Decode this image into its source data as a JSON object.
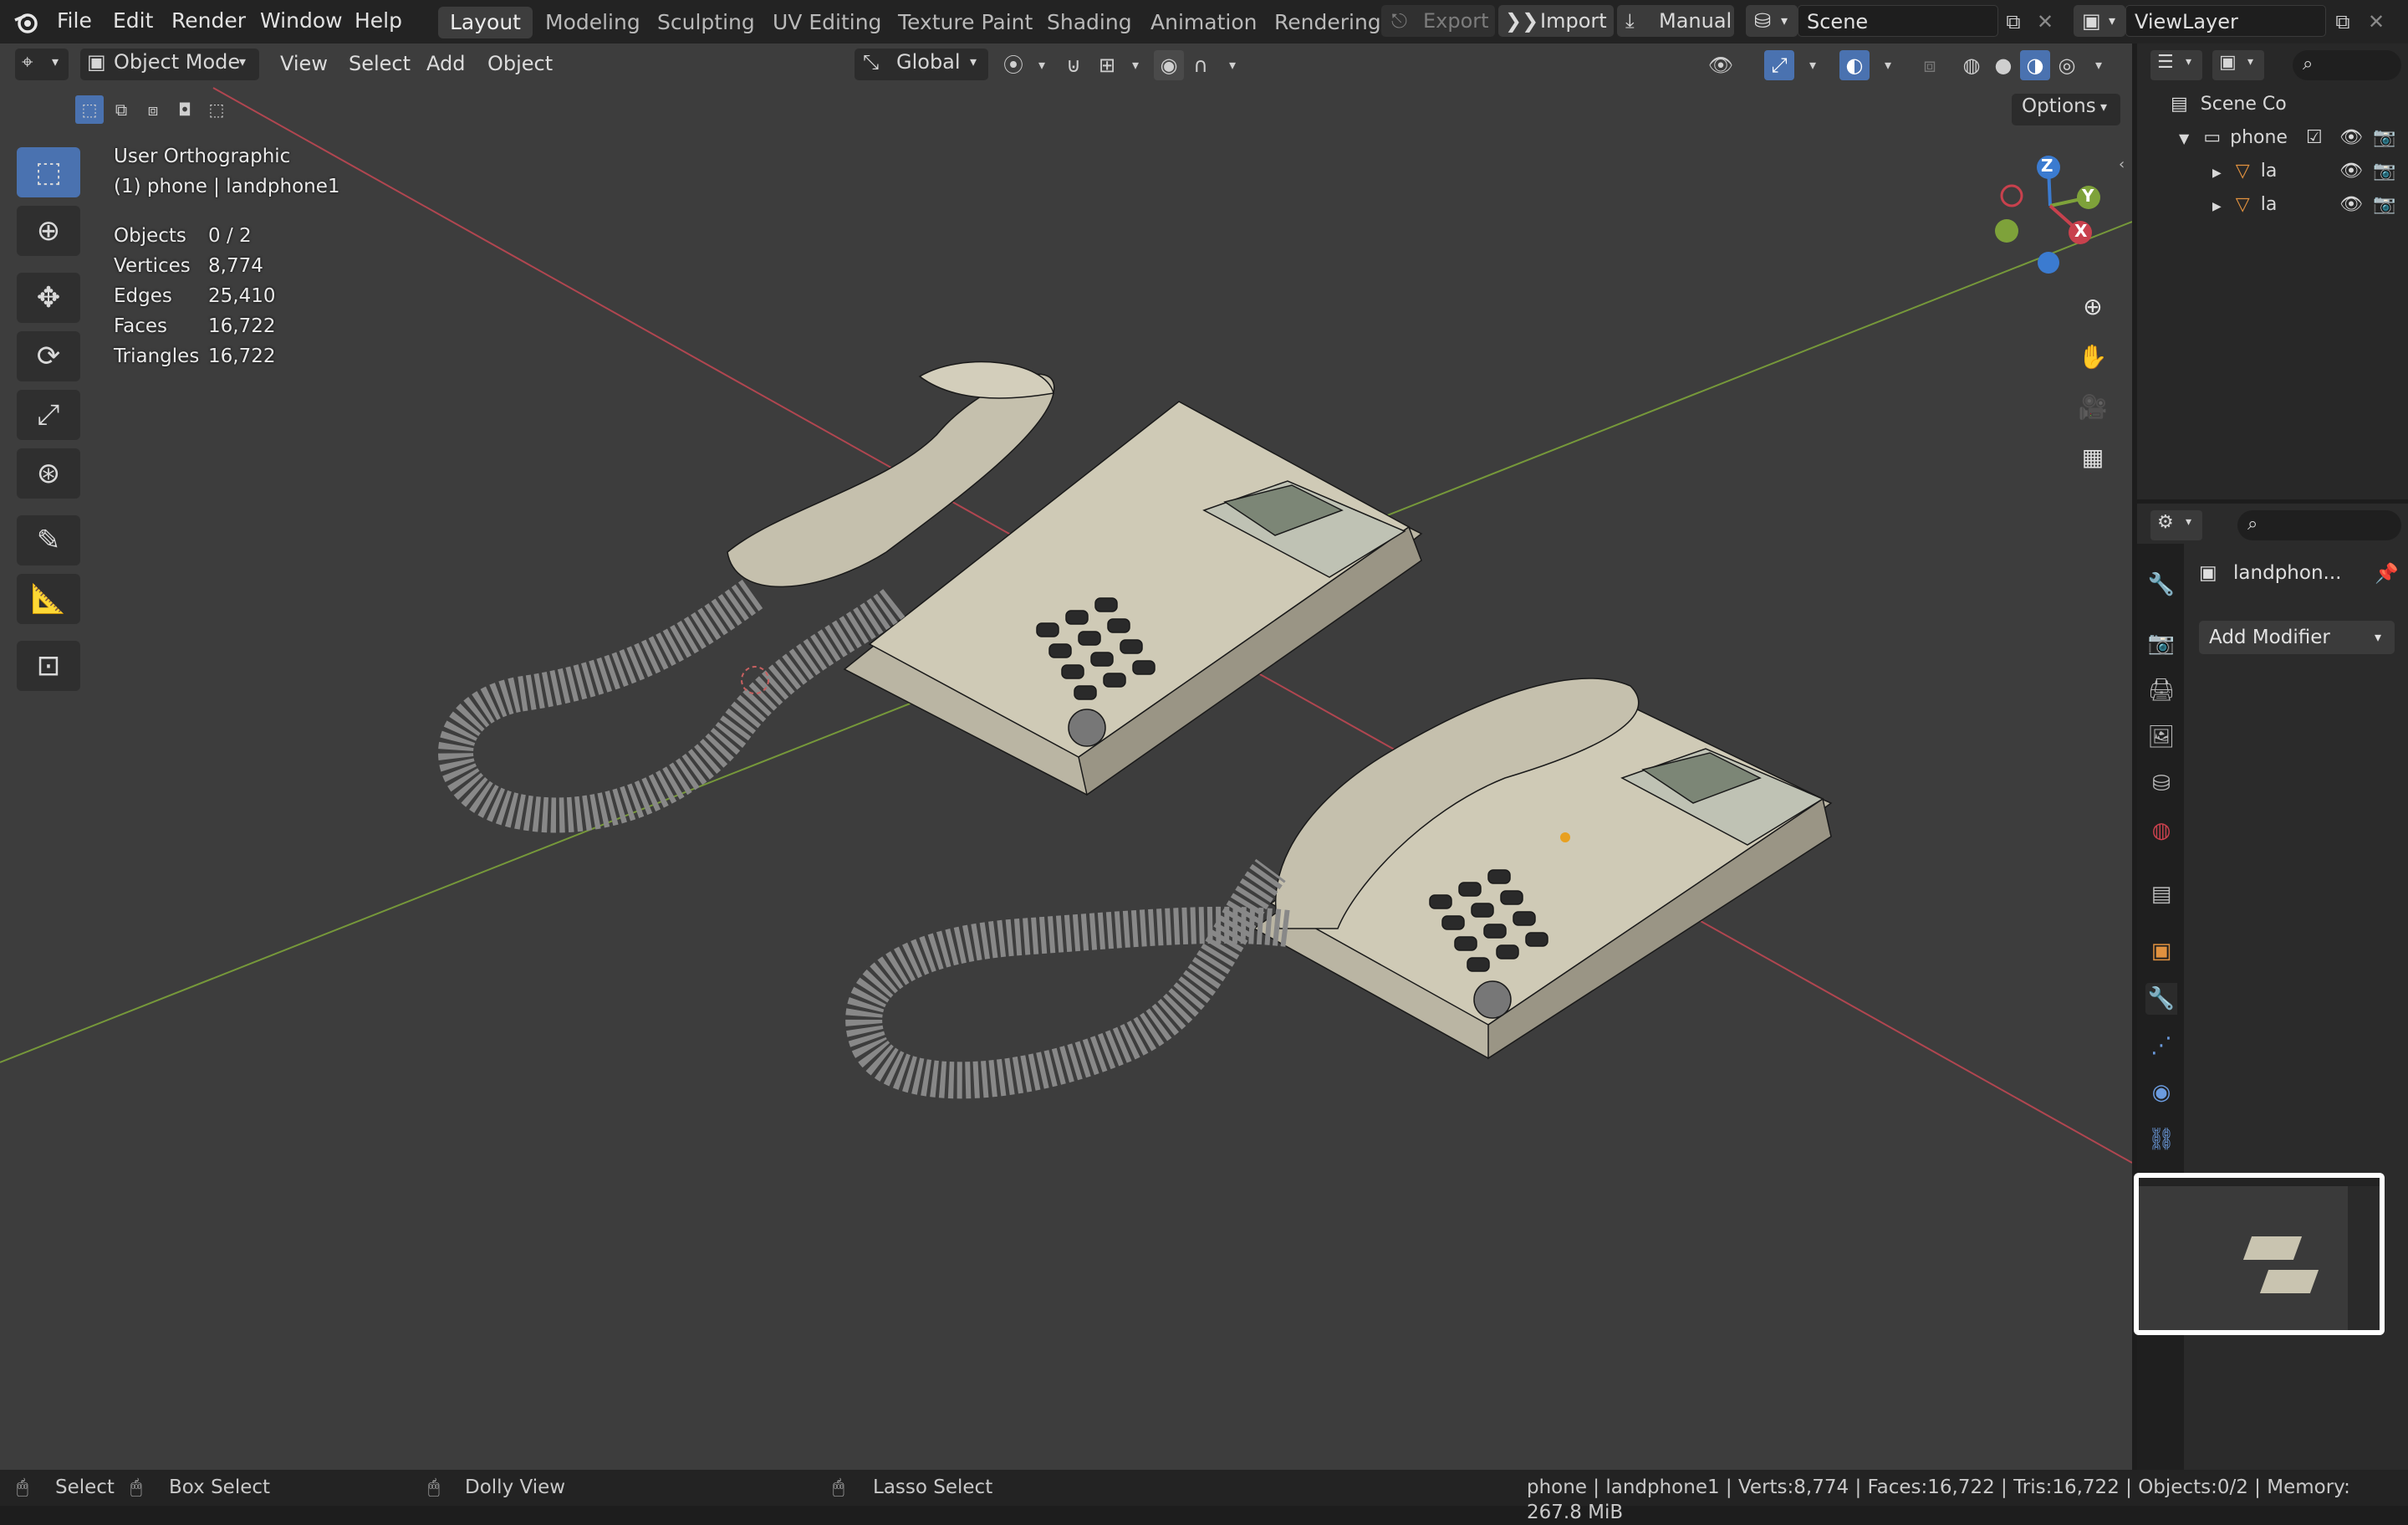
{
  "menu": {
    "items": [
      "File",
      "Edit",
      "Render",
      "Window",
      "Help"
    ],
    "workspaces": [
      "Layout",
      "Modeling",
      "Sculpting",
      "UV Editing",
      "Texture Paint",
      "Shading",
      "Animation",
      "Rendering"
    ],
    "active_workspace": "Layout",
    "export_label": "Export",
    "import_label": "Import",
    "manual_label": "Manual",
    "scene_value": "Scene",
    "viewlayer_value": "ViewLayer"
  },
  "viewport_header": {
    "mode": "Object Mode",
    "menus": [
      "View",
      "Select",
      "Add",
      "Object"
    ],
    "orientation": "Global",
    "options_label": "Options"
  },
  "overlay": {
    "view_name": "User Orthographic",
    "selection": "(1) phone | landphone1",
    "stats": [
      {
        "label": "Objects",
        "value": "0 / 2"
      },
      {
        "label": "Vertices",
        "value": "8,774"
      },
      {
        "label": "Edges",
        "value": "25,410"
      },
      {
        "label": "Faces",
        "value": "16,722"
      },
      {
        "label": "Triangles",
        "value": "16,722"
      }
    ]
  },
  "gizmo": {
    "x_label": "X",
    "y_label": "Y",
    "z_label": "Z"
  },
  "outliner": {
    "scene_collection": "Scene Co",
    "collection": "phone",
    "children": [
      "la",
      "la"
    ]
  },
  "properties": {
    "object_name": "landphon...",
    "add_modifier_label": "Add Modifier"
  },
  "statusbar": {
    "select": "Select",
    "box_select": "Box Select",
    "dolly_view": "Dolly View",
    "lasso_select": "Lasso Select",
    "info": "phone | landphone1 | Verts:8,774 | Faces:16,722 | Tris:16,722 | Objects:0/2 | Memory: 267.8 MiB"
  },
  "colors": {
    "accent": "#4a72b0",
    "x_axis": "#c8414d",
    "y_axis": "#7ea23a",
    "z_axis": "#3b7bd0",
    "phone_body": "#cfcab6"
  }
}
